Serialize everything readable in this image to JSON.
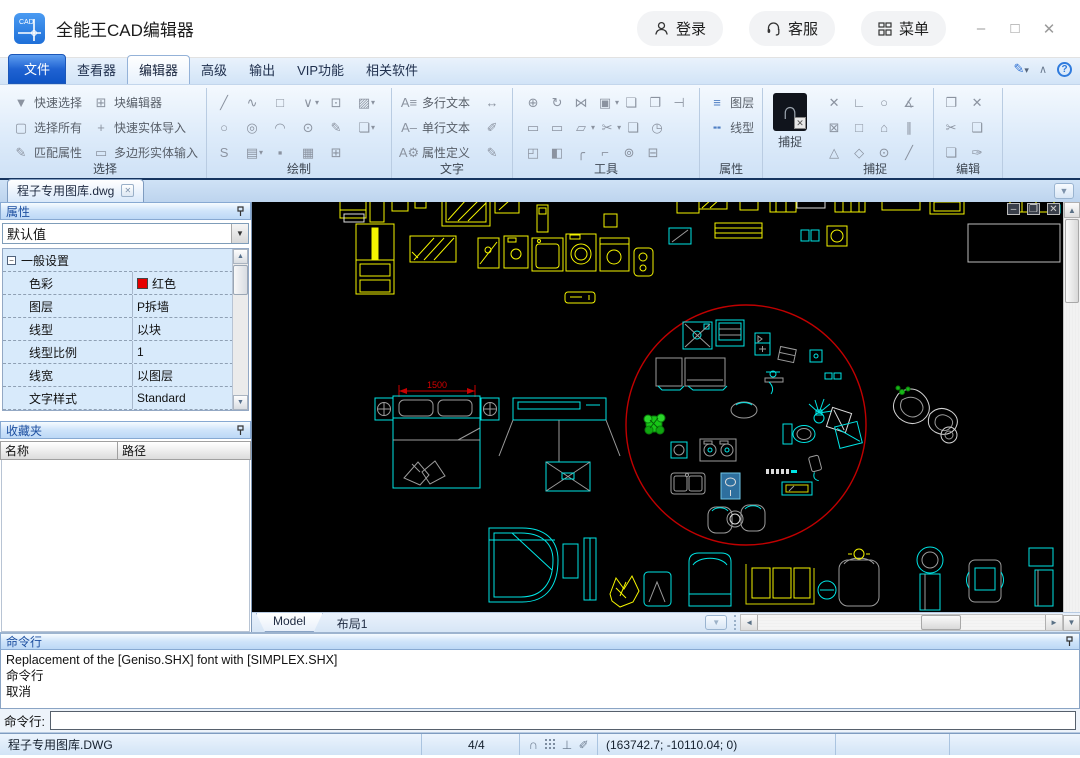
{
  "titlebar": {
    "logo": "CAD",
    "app_title": "全能王CAD编辑器",
    "login": "登录",
    "service": "客服",
    "menu": "菜单"
  },
  "menubar": {
    "tabs": [
      "文件",
      "查看器",
      "编辑器",
      "高级",
      "输出",
      "VIP功能",
      "相关软件"
    ]
  },
  "ribbon": {
    "selection": {
      "label": "选择",
      "items": [
        "快速选择",
        "选择所有",
        "匹配属性",
        "块编辑器",
        "快速实体导入",
        "多边形实体输入"
      ]
    },
    "draw": {
      "label": "绘制"
    },
    "text": {
      "label": "文字",
      "items": [
        "多行文本",
        "单行文本",
        "属性定义"
      ]
    },
    "tools": {
      "label": "工具"
    },
    "props": {
      "label": "属性",
      "items": [
        "图层",
        "线型"
      ]
    },
    "snap": {
      "label": "捕捉",
      "magnet": "捕捉"
    },
    "edit": {
      "label": "编辑"
    },
    "icons": {
      "dd": "▾",
      "selection": [
        "▼",
        "▢",
        "✎",
        "⊞",
        "+",
        "▭"
      ],
      "draw": [
        "╱",
        "∿",
        "□",
        "∨",
        "⊡",
        "▨",
        "○",
        "◎",
        "◠",
        "⊙",
        "✎",
        "❏",
        "S",
        "▤",
        "▪",
        "▦",
        "⊞"
      ],
      "text_side": [
        "↔",
        "✐",
        "✎"
      ],
      "tools": [
        "⊕",
        "↻",
        "⋈",
        "▣",
        "❏",
        "❐",
        "⊣",
        "▭",
        "▭",
        "▱",
        "✂",
        "❑",
        "◷",
        "◰",
        "◧",
        "╭",
        "⌐",
        "⊚",
        "⊟"
      ],
      "snap": [
        "✕",
        "∟",
        "○",
        "∡",
        "⊠",
        "□",
        "⌂",
        "∥",
        "△",
        "◇",
        "⊙",
        "╱"
      ],
      "edit": [
        "❐",
        "✕",
        "✂",
        "❑",
        "❏",
        "✑"
      ],
      "layers": "≡",
      "linetype": "╍"
    }
  },
  "doctab": {
    "name": "程子专用图库.dwg"
  },
  "props_panel": {
    "title": "属性",
    "preset": "默认值",
    "category": "一般设置",
    "color_swatch": "#e60000",
    "rows": [
      {
        "label": "色彩",
        "value": "红色"
      },
      {
        "label": "图层",
        "value": "P拆墙"
      },
      {
        "label": "线型",
        "value": "以块"
      },
      {
        "label": "线型比例",
        "value": "1"
      },
      {
        "label": "线宽",
        "value": "以图层"
      },
      {
        "label": "文字样式",
        "value": "Standard"
      }
    ]
  },
  "favorites": {
    "title": "收藏夹",
    "col_name": "名称",
    "col_path": "路径"
  },
  "canvas": {
    "dim_label": "1500",
    "model_tab": "Model",
    "layout_tab": "布局1"
  },
  "command": {
    "title": "命令行",
    "lines": [
      "Replacement of the [Geniso.SHX] font with [SIMPLEX.SHX]",
      "命令行",
      "取消"
    ],
    "prompt": "命令行:"
  },
  "statusbar": {
    "file": "程子专用图库.DWG",
    "page": "4/4",
    "coords": "(163742.7; -10110.04; 0)"
  }
}
